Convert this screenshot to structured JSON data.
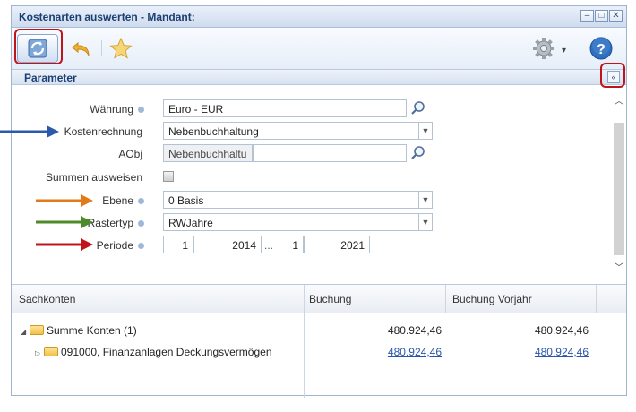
{
  "window": {
    "title": "Kostenarten auswerten - Mandant:",
    "buttons": [
      "–",
      "□",
      "✕"
    ]
  },
  "toolbar": {
    "icons": [
      "refresh-icon",
      "undo-icon",
      "star-icon",
      "gear-icon",
      "help-icon"
    ],
    "gear_dropdown": "▾"
  },
  "parameter": {
    "title": "Parameter",
    "collapse_label": "«"
  },
  "form": {
    "waehrung": {
      "label": "Währung",
      "value": "Euro - EUR"
    },
    "kostenrechnung": {
      "label": "Kostenrechnung",
      "value": "Nebenbuchhaltung"
    },
    "aobj": {
      "label": "AObj",
      "prefix": "Nebenbuchhaltu",
      "value": ""
    },
    "summen": {
      "label": "Summen ausweisen",
      "checked": false
    },
    "ebene": {
      "label": "Ebene",
      "value": "0 Basis"
    },
    "rastertyp": {
      "label": "Rastertyp",
      "value": "RWJahre"
    },
    "periode": {
      "label": "Periode",
      "from_period": "1",
      "from_year": "2014",
      "ellipsis": "...",
      "to_period": "1",
      "to_year": "2021"
    }
  },
  "grid": {
    "columns": [
      "Sachkonten",
      "Buchung",
      "Buchung Vorjahr"
    ],
    "rows": [
      {
        "label": "Summe Konten (1)",
        "buchung": "480.924,46",
        "vorjahr": "480.924,46",
        "link": false
      },
      {
        "label": "091000, Finanzanlagen Deckungsvermögen",
        "buchung": "480.924,46",
        "vorjahr": "480.924,46",
        "link": true
      }
    ]
  },
  "colors": {
    "highlight_ring": "#c0141b",
    "arrow_kostenrechnung": "#2b5aa8",
    "arrow_ebene": "#e07a1a",
    "arrow_rastertyp": "#4f8a2a",
    "arrow_periode": "#c0141b"
  }
}
